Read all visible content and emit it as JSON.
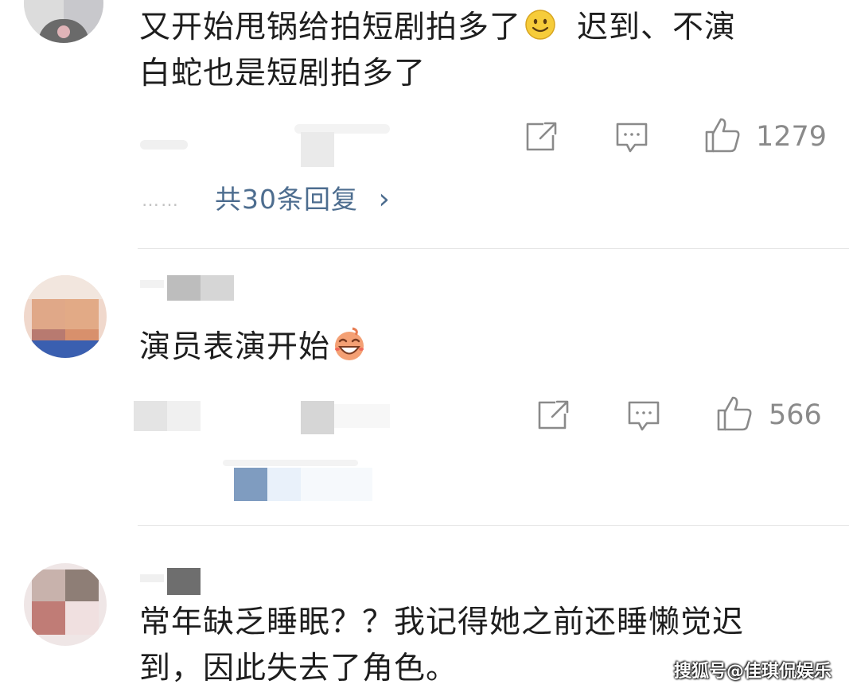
{
  "comments": [
    {
      "text_line1": "又开始甩锅给拍短剧拍多了",
      "text_line1_tail": "迟到、不演",
      "text_line2": "白蛇也是短剧拍多了",
      "emoji": "smile-emoji",
      "likes": "1279",
      "replies_label": "共30条回复",
      "replies_chevron": "›",
      "ellipsis": "……"
    },
    {
      "text": "演员表演开始",
      "emoji": "grin-emoji",
      "likes": "566"
    },
    {
      "text_line1": "常年缺乏睡眠？？我记得她之前还睡懒觉迟",
      "text_line2": "到，因此失去了角色。"
    }
  ],
  "watermark": "搜狐号@佳琪侃娱乐",
  "icons": {
    "share": "share-icon",
    "comment": "comment-icon",
    "like": "thumbs-up-icon"
  },
  "colors": {
    "link": "#4d6d8f",
    "icon": "#8a8a8a",
    "text": "#1e1e1e"
  }
}
